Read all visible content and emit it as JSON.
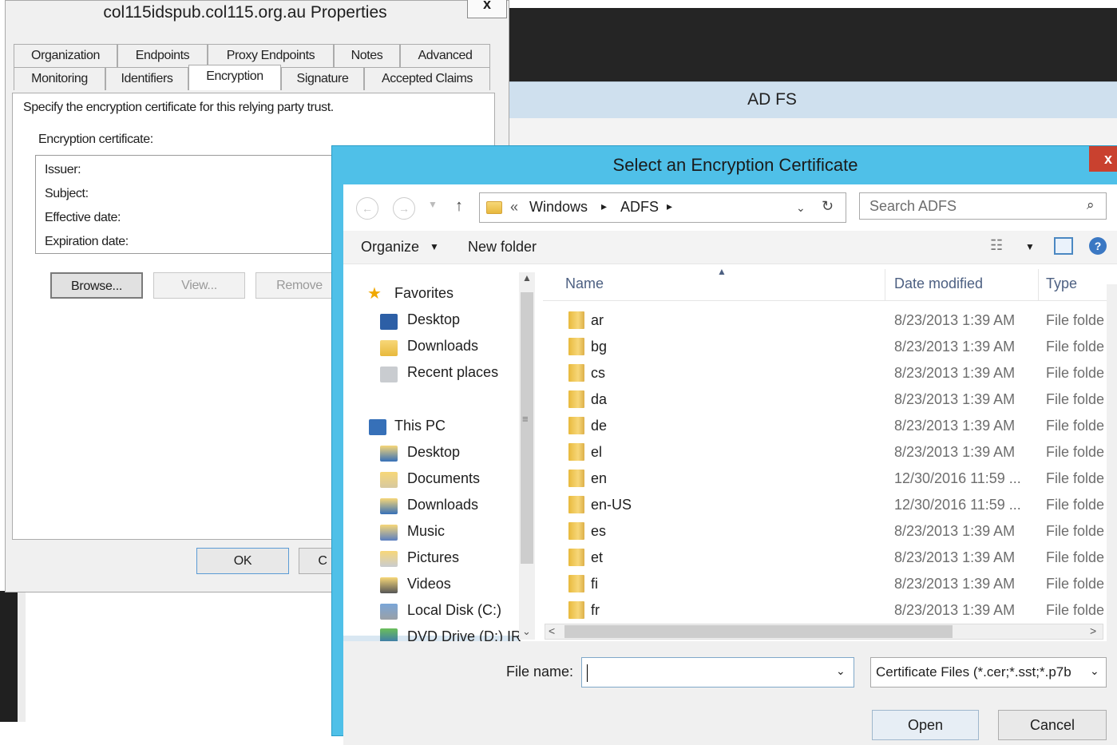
{
  "background_app": {
    "title": "AD FS"
  },
  "properties_dialog": {
    "title": "col115idspub.col115.org.au Properties",
    "close_label": "x",
    "tabs_row1": [
      "Organization",
      "Endpoints",
      "Proxy Endpoints",
      "Notes",
      "Advanced"
    ],
    "tabs_row2": [
      "Monitoring",
      "Identifiers",
      "Encryption",
      "Signature",
      "Accepted Claims"
    ],
    "active_tab": "Encryption",
    "description": "Specify the encryption certificate for this relying party trust.",
    "cert_heading": "Encryption certificate:",
    "fields": [
      "Issuer:",
      "Subject:",
      "Effective date:",
      "Expiration date:"
    ],
    "buttons": {
      "browse": "Browse...",
      "view": "View...",
      "remove": "Remove"
    },
    "ok": "OK",
    "cancel_partial": "C"
  },
  "file_dialog": {
    "title": "Select an Encryption Certificate",
    "close_label": "x",
    "breadcrumb": {
      "prefix": "«",
      "parts": [
        "Windows",
        "ADFS"
      ]
    },
    "search_placeholder": "Search ADFS",
    "commands": {
      "organize": "Organize",
      "new_folder": "New folder"
    },
    "nav": {
      "favorites": "Favorites",
      "favorites_items": [
        "Desktop",
        "Downloads",
        "Recent places"
      ],
      "this_pc": "This PC",
      "pc_items": [
        "Desktop",
        "Documents",
        "Downloads",
        "Music",
        "Pictures",
        "Videos",
        "Local Disk (C:)",
        "DVD Drive (D:) IR"
      ]
    },
    "columns": {
      "name": "Name",
      "date": "Date modified",
      "type": "Type"
    },
    "files": [
      {
        "name": "ar",
        "date": "8/23/2013 1:39 AM",
        "type": "File folde"
      },
      {
        "name": "bg",
        "date": "8/23/2013 1:39 AM",
        "type": "File folde"
      },
      {
        "name": "cs",
        "date": "8/23/2013 1:39 AM",
        "type": "File folde"
      },
      {
        "name": "da",
        "date": "8/23/2013 1:39 AM",
        "type": "File folde"
      },
      {
        "name": "de",
        "date": "8/23/2013 1:39 AM",
        "type": "File folde"
      },
      {
        "name": "el",
        "date": "8/23/2013 1:39 AM",
        "type": "File folde"
      },
      {
        "name": "en",
        "date": "12/30/2016 11:59 ...",
        "type": "File folde"
      },
      {
        "name": "en-US",
        "date": "12/30/2016 11:59 ...",
        "type": "File folde"
      },
      {
        "name": "es",
        "date": "8/23/2013 1:39 AM",
        "type": "File folde"
      },
      {
        "name": "et",
        "date": "8/23/2013 1:39 AM",
        "type": "File folde"
      },
      {
        "name": "fi",
        "date": "8/23/2013 1:39 AM",
        "type": "File folde"
      },
      {
        "name": "fr",
        "date": "8/23/2013 1:39 AM",
        "type": "File folde"
      }
    ],
    "file_name_label": "File name:",
    "file_name_value": "",
    "file_type": "Certificate Files (*.cer;*.sst;*.p7b",
    "open": "Open",
    "cancel": "Cancel"
  }
}
